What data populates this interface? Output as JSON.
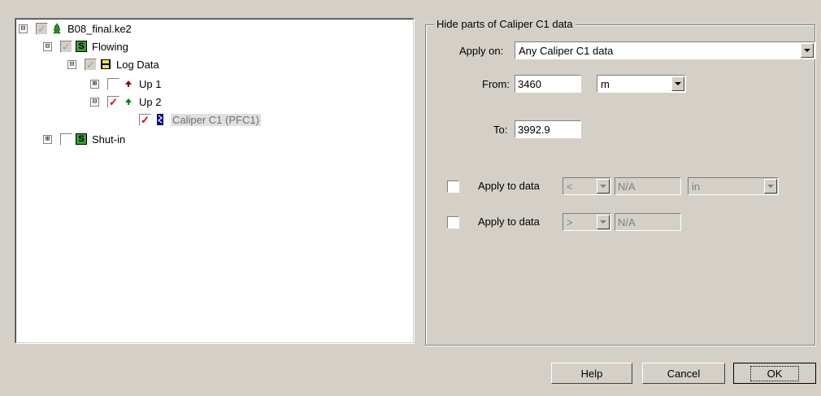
{
  "tree": {
    "root": {
      "label": "B08_final.ke2",
      "expander": "⊟"
    },
    "flowing": {
      "label": "Flowing",
      "expander": "⊟",
      "icon": "S"
    },
    "log_data": {
      "label": "Log Data",
      "expander": "⊟"
    },
    "up1": {
      "label": "Up 1",
      "expander": "⊞"
    },
    "up2": {
      "label": "Up 2",
      "expander": "⊟"
    },
    "caliper": {
      "label": "Caliper C1 (PFC1)"
    },
    "shutin": {
      "label": "Shut-in",
      "expander": "⊞",
      "icon": "S"
    },
    "check": "✓"
  },
  "group": {
    "title": "Hide parts of Caliper C1 data",
    "apply_on_label": "Apply on:",
    "apply_on_value": "Any Caliper C1 data",
    "from_label": "From:",
    "from_value": "3460",
    "unit_value": "m",
    "to_label": "To:",
    "to_value": "3992.9",
    "row1": {
      "label": "Apply to data",
      "op": "<",
      "value": "N/A",
      "unit": "in"
    },
    "row2": {
      "label": "Apply to data",
      "op": ">",
      "value": "N/A"
    }
  },
  "buttons": {
    "help": "Help",
    "cancel": "Cancel",
    "ok": "OK"
  },
  "colors": {
    "dialog_bg": "#d4d0c8",
    "check_red": "#e00000"
  }
}
